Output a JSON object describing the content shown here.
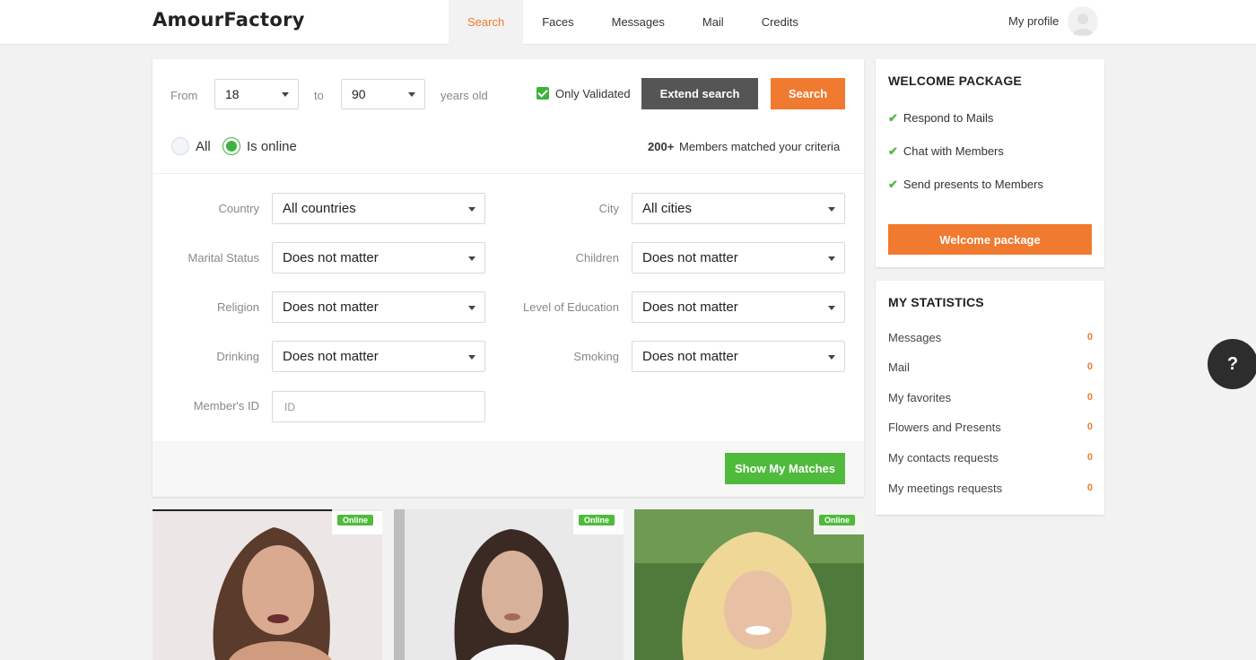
{
  "header": {
    "logo": "AmourFactory",
    "nav": [
      "Search",
      "Faces",
      "Messages",
      "Mail",
      "Credits"
    ],
    "active_nav": "Search",
    "profile_label": "My profile"
  },
  "search": {
    "from_label": "From",
    "age_from": "18",
    "to_label": "to",
    "age_to": "90",
    "years_label": "years old",
    "only_validated": "Only Validated",
    "extend_button": "Extend search",
    "search_button": "Search",
    "radio_all": "All",
    "radio_online": "Is online",
    "matched_count": "200+",
    "matched_text": "Members matched your criteria",
    "criteria": [
      {
        "label": "Country",
        "value": "All countries"
      },
      {
        "label": "City",
        "value": "All cities"
      },
      {
        "label": "Marital Status",
        "value": "Does not matter"
      },
      {
        "label": "Children",
        "value": "Does not matter"
      },
      {
        "label": "Religion",
        "value": "Does not matter"
      },
      {
        "label": "Level of Education",
        "value": "Does not matter"
      },
      {
        "label": "Drinking",
        "value": "Does not matter"
      },
      {
        "label": "Smoking",
        "value": "Does not matter"
      }
    ],
    "member_id_label": "Member's ID",
    "member_id_placeholder": "ID",
    "show_matches_button": "Show My Matches"
  },
  "welcome": {
    "title": "WELCOME PACKAGE",
    "items": [
      "Respond to Mails",
      "Chat with Members",
      "Send presents to Members"
    ],
    "button": "Welcome package"
  },
  "stats": {
    "title": "MY STATISTICS",
    "rows": [
      {
        "label": "Messages",
        "value": "0"
      },
      {
        "label": "Mail",
        "value": "0"
      },
      {
        "label": "My favorites",
        "value": "0"
      },
      {
        "label": "Flowers and Presents",
        "value": "0"
      },
      {
        "label": "My contacts requests",
        "value": "0"
      },
      {
        "label": "My meetings requests",
        "value": "0"
      }
    ]
  },
  "help": "?",
  "cards": [
    {
      "badge": "Online"
    },
    {
      "badge": "Online"
    },
    {
      "badge": "Online"
    }
  ],
  "colors": {
    "accent_orange": "#f07a2f",
    "online_green": "#4fba3c",
    "dark_button": "#555555"
  }
}
